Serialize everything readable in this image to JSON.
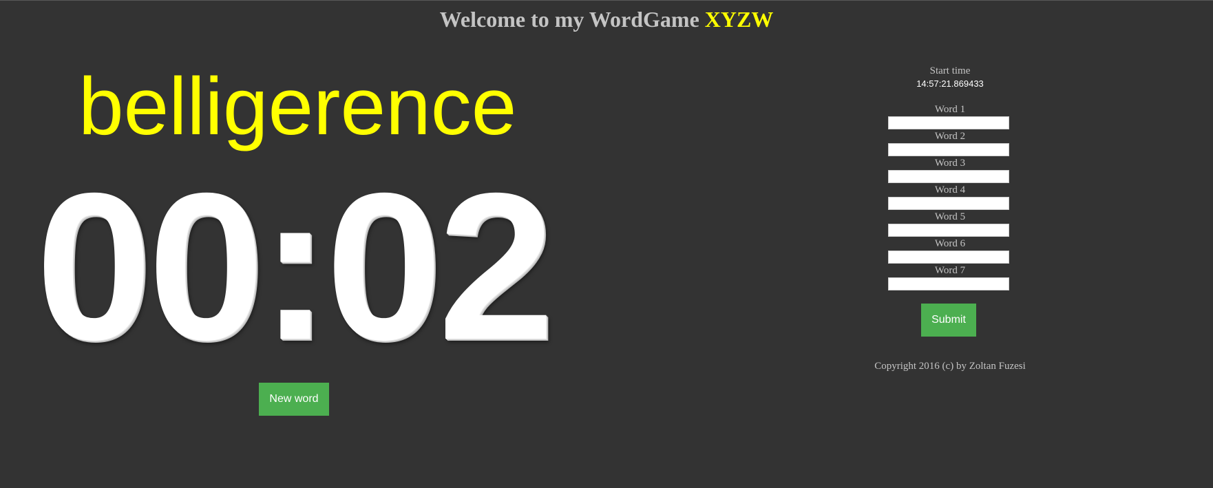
{
  "header": {
    "title_prefix": "Welcome to my WordGame",
    "title_accent": "XYZW"
  },
  "game": {
    "current_word": "belligerence",
    "timer": "00:02",
    "new_word_label": "New word"
  },
  "panel": {
    "start_time_label": "Start time",
    "start_time_value": "14:57:21.869433",
    "word_fields": [
      {
        "label": "Word 1",
        "value": ""
      },
      {
        "label": "Word 2",
        "value": ""
      },
      {
        "label": "Word 3",
        "value": ""
      },
      {
        "label": "Word 4",
        "value": ""
      },
      {
        "label": "Word 5",
        "value": ""
      },
      {
        "label": "Word 6",
        "value": ""
      },
      {
        "label": "Word 7",
        "value": ""
      }
    ],
    "submit_label": "Submit",
    "copyright": "Copyright 2016 (c) by Zoltan Fuzesi"
  },
  "colors": {
    "background": "#333333",
    "accent_yellow": "#ffff00",
    "button_green": "#4caf50",
    "text_gray": "#c4c4c4"
  }
}
